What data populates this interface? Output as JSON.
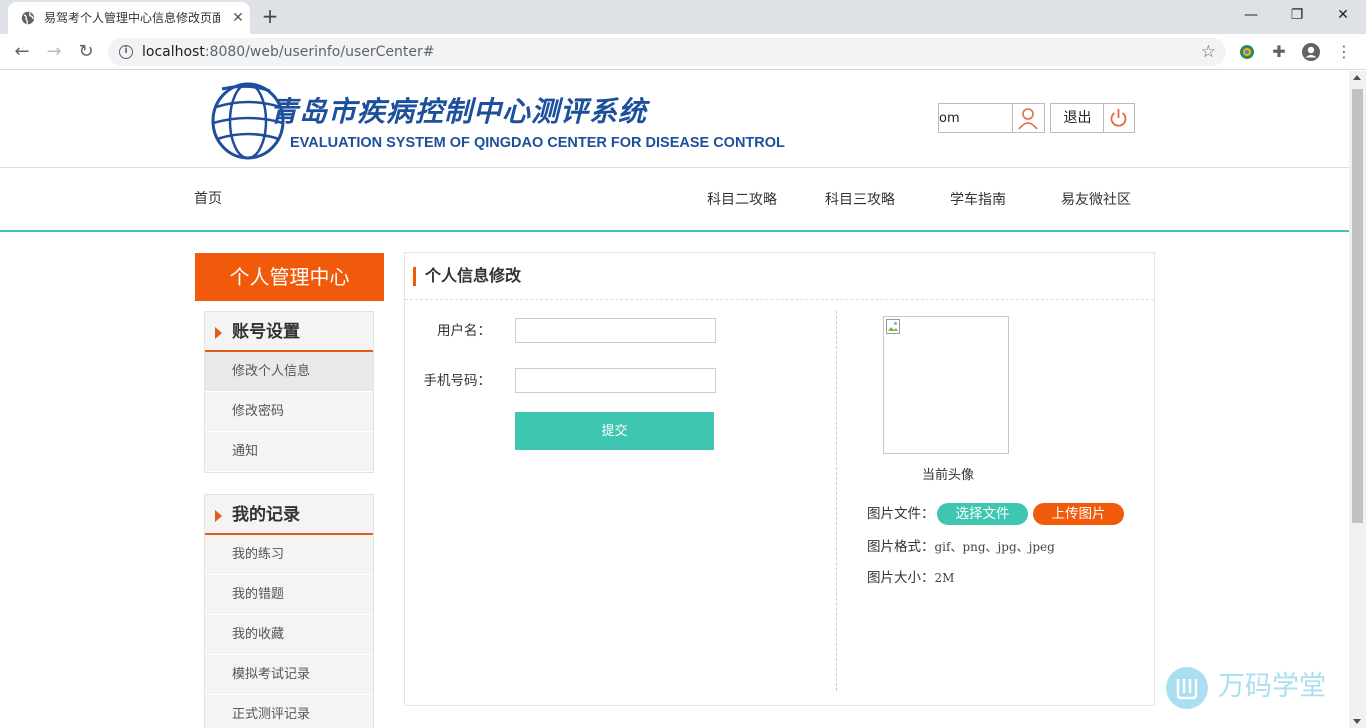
{
  "browser": {
    "tab_title": "易驾考个人管理中心信息修改页面",
    "tab_close": "✕",
    "new_tab": "+",
    "url_host": "localhost",
    "url_rest": ":8080/web/userinfo/userCenter#",
    "window_controls": {
      "minimize": "—",
      "restore": "❐",
      "close": "✕"
    }
  },
  "header": {
    "logo_cn": "青岛市疾病控制中心测评系统",
    "logo_en": "EVALUATION SYSTEM OF QINGDAO CENTER FOR DISEASE CONTROL",
    "user_name": "om",
    "logout_label": "退出"
  },
  "nav": {
    "home": "首页",
    "items": [
      "科目二攻略",
      "科目三攻略",
      "学车指南",
      "易友微社区"
    ]
  },
  "sidebar": {
    "title": "个人管理中心",
    "groups": [
      {
        "label": "账号设置",
        "links": [
          "修改个人信息",
          "修改密码",
          "通知"
        ]
      },
      {
        "label": "我的记录",
        "links": [
          "我的练习",
          "我的错题",
          "我的收藏",
          "模拟考试记录",
          "正式测评记录"
        ]
      }
    ]
  },
  "panel": {
    "title": "个人信息修改",
    "username_label": "用户名：",
    "username_value": "",
    "phone_label": "手机号码：",
    "phone_value": "",
    "submit_label": "提交",
    "avatar_caption": "当前头像",
    "file_label": "图片文件：",
    "choose_file": "选择文件",
    "upload_image": "上传图片",
    "format_label": "图片格式：",
    "format_value": "gif、png、jpg、jpeg",
    "size_label": "图片大小：",
    "size_value": "2M"
  },
  "watermark": {
    "text": "万码学堂"
  },
  "colors": {
    "accent_orange": "#f05a0a",
    "accent_teal": "#3ec6b0",
    "logo_blue": "#1d4f9c"
  }
}
